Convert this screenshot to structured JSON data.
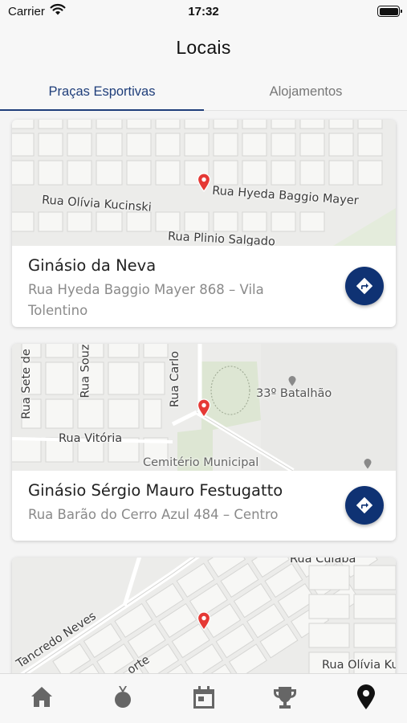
{
  "status_bar": {
    "carrier": "Carrier",
    "time": "17:32"
  },
  "header": {
    "title": "Locais"
  },
  "tabs": [
    {
      "label": "Praças Esportivas",
      "active": true
    },
    {
      "label": "Alojamentos",
      "active": false
    }
  ],
  "colors": {
    "accent": "#1f3e7a",
    "button": "#0f3273",
    "pin": "#e53935"
  },
  "places": [
    {
      "name": "Ginásio da Neva",
      "address": "Rua Hyeda Baggio Mayer 868 – Vila Tolentino",
      "map_labels": [
        "Rua Hyeda Baggio Mayer",
        "Rua Olívia Kucinski",
        "Rua Plinio Salgado"
      ]
    },
    {
      "name": "Ginásio Sérgio Mauro Festugatto",
      "address": "Rua Barão do Cerro Azul 484 – Centro",
      "map_labels": [
        "Rua Sete de",
        "Rua Souz",
        "Rua Carlo",
        "Rua Vitória",
        "33º Batalhão",
        "Cemitério Municipal"
      ]
    },
    {
      "name": "",
      "address": "",
      "map_labels": [
        "Rua Cuiabá",
        "Tancredo Neves",
        "Rua Olívia Ku",
        "orte"
      ]
    }
  ],
  "bottom_tabs": [
    {
      "icon": "home-icon",
      "active": false
    },
    {
      "icon": "medal-icon",
      "active": false
    },
    {
      "icon": "calendar-icon",
      "active": false
    },
    {
      "icon": "trophy-icon",
      "active": false
    },
    {
      "icon": "location-pin-icon",
      "active": true
    }
  ]
}
